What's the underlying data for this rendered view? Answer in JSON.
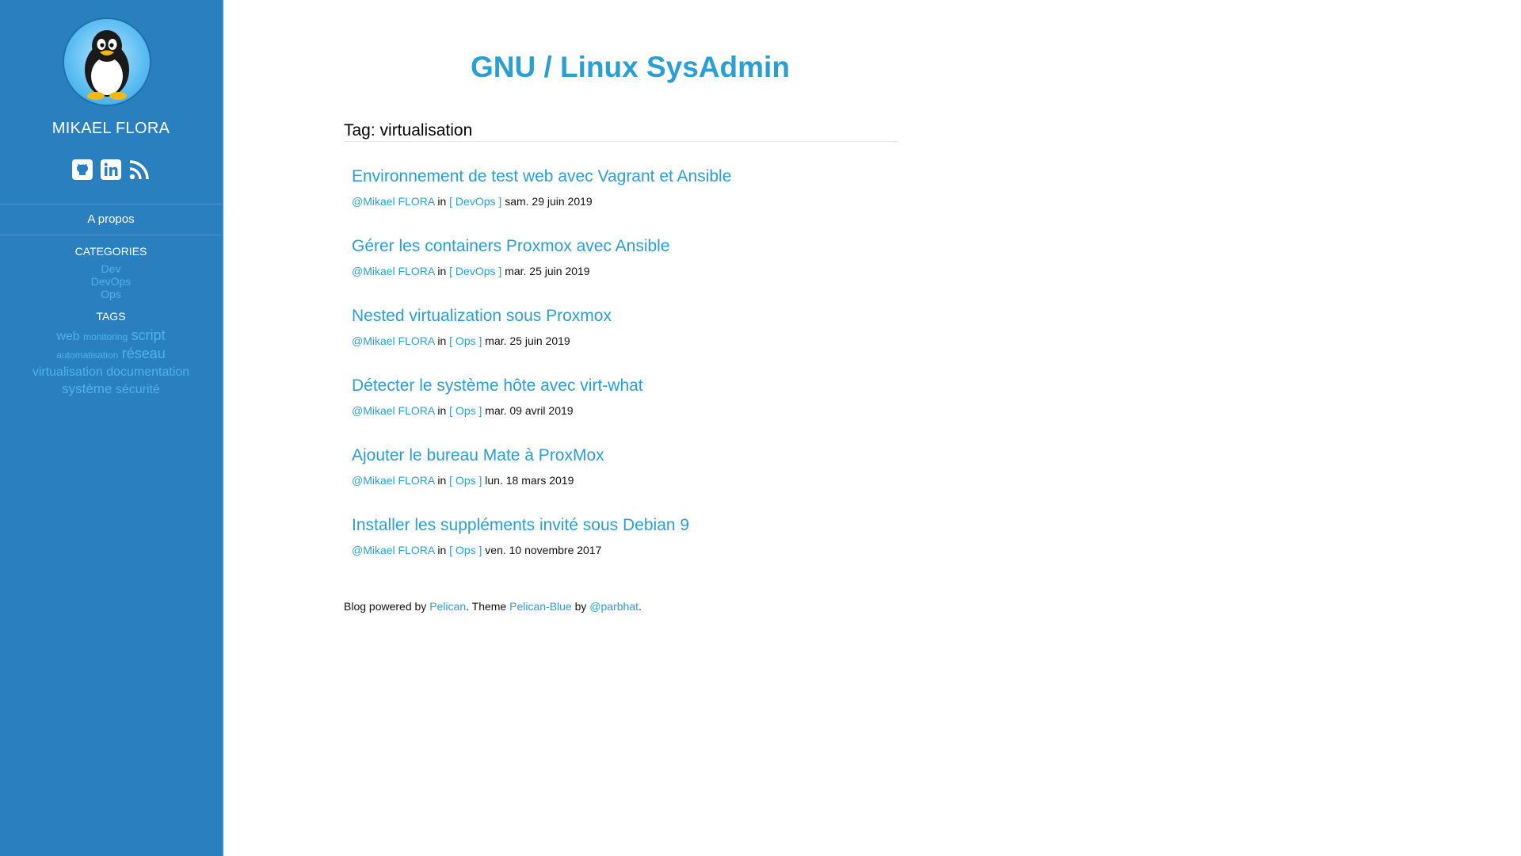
{
  "sidebar": {
    "author_name": "MIKAEL FLORA",
    "social": [
      {
        "icon": "github-icon"
      },
      {
        "icon": "linkedin-icon"
      },
      {
        "icon": "rss-icon"
      }
    ],
    "about_label": "A propos",
    "categories_title": "CATEGORIES",
    "categories": [
      "Dev",
      "DevOps",
      "Ops"
    ],
    "tags_title": "TAGS",
    "tags": [
      {
        "label": "web",
        "size": 16
      },
      {
        "label": "monitoring",
        "size": 12
      },
      {
        "label": "script",
        "size": 18
      },
      {
        "label": "automatisation",
        "size": 12
      },
      {
        "label": "réseau",
        "size": 18
      },
      {
        "label": "virtualisation",
        "size": 16
      },
      {
        "label": "documentation",
        "size": 16
      },
      {
        "label": "système",
        "size": 17
      },
      {
        "label": "sécurité",
        "size": 16
      }
    ]
  },
  "header": {
    "site_title": "GNU / Linux SysAdmin"
  },
  "page": {
    "tag_heading": "Tag: virtualisation"
  },
  "articles": [
    {
      "title": "Environnement de test web avec Vagrant et Ansible",
      "author": "@Mikael FLORA",
      "in_label": "in",
      "category": "[ DevOps ]",
      "date": "sam. 29 juin 2019"
    },
    {
      "title": "Gérer les containers Proxmox avec Ansible",
      "author": "@Mikael FLORA",
      "in_label": "in",
      "category": "[ DevOps ]",
      "date": "mar. 25 juin 2019"
    },
    {
      "title": "Nested virtualization sous Proxmox",
      "author": "@Mikael FLORA",
      "in_label": "in",
      "category": "[ Ops ]",
      "date": "mar. 25 juin 2019"
    },
    {
      "title": "Détecter le système hôte avec virt-what",
      "author": "@Mikael FLORA",
      "in_label": "in",
      "category": "[ Ops ]",
      "date": "mar. 09 avril 2019"
    },
    {
      "title": "Ajouter le bureau Mate à ProxMox",
      "author": "@Mikael FLORA",
      "in_label": "in",
      "category": "[ Ops ]",
      "date": "lun. 18 mars 2019"
    },
    {
      "title": "Installer les suppléments invité sous Debian 9",
      "author": "@Mikael FLORA",
      "in_label": "in",
      "category": "[ Ops ]",
      "date": "ven. 10 novembre 2017"
    }
  ],
  "footer": {
    "text1": "Blog powered by",
    "link1": "Pelican",
    "text2": ". Theme",
    "link2": "Pelican-Blue",
    "text3": "by",
    "link3": "@parbhat",
    "text4": "."
  },
  "colors": {
    "sidebar_bg": "#2a80bf",
    "accent": "#2a9fd6",
    "sidebar_link": "#4fb2e8"
  }
}
